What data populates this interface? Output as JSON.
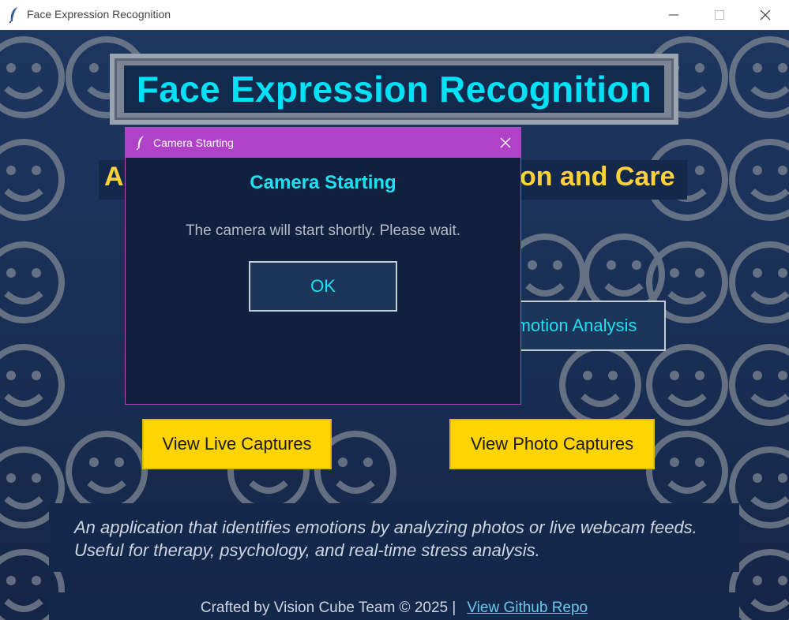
{
  "window": {
    "title": "Face Expression Recognition",
    "icon": "feather-icon"
  },
  "app": {
    "title": "Face Expression Recognition",
    "subtitle": "A",
    "subtitle_right": "on and Care",
    "analysis_button": "motion Analysis",
    "view_live_button": "View Live Captures",
    "view_photo_button": "View Photo Captures",
    "description": "An application that identifies emotions by analyzing photos or live webcam feeds. Useful for therapy, psychology, and real-time stress analysis.",
    "footer_text": "Crafted by Vision Cube Team © 2025 |",
    "footer_link": "View Github Repo"
  },
  "dialog": {
    "window_title": "Camera Starting",
    "heading": "Camera Starting",
    "message": "The camera will start shortly. Please wait.",
    "ok_button": "OK"
  },
  "colors": {
    "accent_cyan": "#1ee0f2",
    "title_cyan": "#00e1f5",
    "subtitle_yellow": "#ffd23a",
    "button_yellow": "#ffd400",
    "dialog_titlebar": "#b042c8",
    "background_navy": "#1a2f55"
  }
}
